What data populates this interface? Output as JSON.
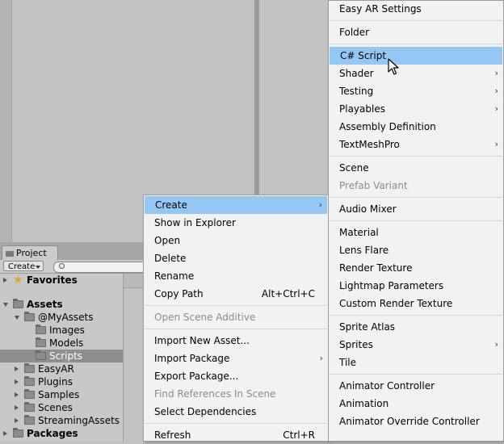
{
  "project_window": {
    "tab_label": "Project",
    "create_label": "Create",
    "tree": [
      {
        "label": "Favorites",
        "bold": true,
        "expanded": false,
        "icon": "star-icon",
        "selected": false
      },
      {
        "label": "Assets",
        "bold": true,
        "expanded": true,
        "icon": "folder-icon",
        "selected": false
      },
      {
        "label": "@MyAssets",
        "bold": false,
        "expanded": true,
        "icon": "folder-icon",
        "selected": false
      },
      {
        "label": "Images",
        "bold": false,
        "icon": "folder-icon",
        "selected": false
      },
      {
        "label": "Models",
        "bold": false,
        "icon": "folder-icon",
        "selected": false
      },
      {
        "label": "Scripts",
        "bold": false,
        "icon": "folder-icon",
        "selected": true
      },
      {
        "label": "EasyAR",
        "bold": false,
        "expanded": false,
        "icon": "folder-icon",
        "selected": false
      },
      {
        "label": "Plugins",
        "bold": false,
        "expanded": false,
        "icon": "folder-icon",
        "selected": false
      },
      {
        "label": "Samples",
        "bold": false,
        "expanded": false,
        "icon": "folder-icon",
        "selected": false
      },
      {
        "label": "Scenes",
        "bold": false,
        "expanded": false,
        "icon": "folder-icon",
        "selected": false
      },
      {
        "label": "StreamingAssets",
        "bold": false,
        "expanded": false,
        "icon": "folder-icon",
        "selected": false
      },
      {
        "label": "Packages",
        "bold": true,
        "expanded": false,
        "icon": "folder-icon",
        "selected": false
      }
    ]
  },
  "context_menu": {
    "items": [
      {
        "label": "Create",
        "submenu": true,
        "highlighted": true
      },
      {
        "label": "Show in Explorer"
      },
      {
        "label": "Open"
      },
      {
        "label": "Delete"
      },
      {
        "label": "Rename"
      },
      {
        "label": "Copy Path",
        "shortcut": "Alt+Ctrl+C"
      },
      {
        "separator": true
      },
      {
        "label": "Open Scene Additive",
        "disabled": true
      },
      {
        "separator": true
      },
      {
        "label": "Import New Asset..."
      },
      {
        "label": "Import Package",
        "submenu": true
      },
      {
        "label": "Export Package..."
      },
      {
        "label": "Find References In Scene",
        "disabled": true
      },
      {
        "label": "Select Dependencies"
      },
      {
        "separator": true
      },
      {
        "label": "Refresh",
        "shortcut": "Ctrl+R"
      }
    ]
  },
  "create_submenu": {
    "items": [
      {
        "label": "Easy AR Settings"
      },
      {
        "separator": true
      },
      {
        "label": "Folder"
      },
      {
        "separator": true
      },
      {
        "label": "C# Script",
        "highlighted": true
      },
      {
        "label": "Shader",
        "submenu": true
      },
      {
        "label": "Testing",
        "submenu": true
      },
      {
        "label": "Playables",
        "submenu": true
      },
      {
        "label": "Assembly Definition"
      },
      {
        "label": "TextMeshPro",
        "submenu": true
      },
      {
        "separator": true
      },
      {
        "label": "Scene"
      },
      {
        "label": "Prefab Variant",
        "disabled": true
      },
      {
        "separator": true
      },
      {
        "label": "Audio Mixer"
      },
      {
        "separator": true
      },
      {
        "label": "Material"
      },
      {
        "label": "Lens Flare"
      },
      {
        "label": "Render Texture"
      },
      {
        "label": "Lightmap Parameters"
      },
      {
        "label": "Custom Render Texture"
      },
      {
        "separator": true
      },
      {
        "label": "Sprite Atlas"
      },
      {
        "label": "Sprites",
        "submenu": true
      },
      {
        "label": "Tile"
      },
      {
        "separator": true
      },
      {
        "label": "Animator Controller"
      },
      {
        "label": "Animation"
      },
      {
        "label": "Animator Override Controller"
      }
    ]
  },
  "icons": {
    "submenu_arrow": "chevron-right-icon",
    "cursor": "mouse-pointer-icon"
  },
  "colors": {
    "highlight": "#95c7f5",
    "menu_bg": "#f2f2f2",
    "disabled_text": "#8c8c8c",
    "selected_row": "#8e8e8e"
  }
}
